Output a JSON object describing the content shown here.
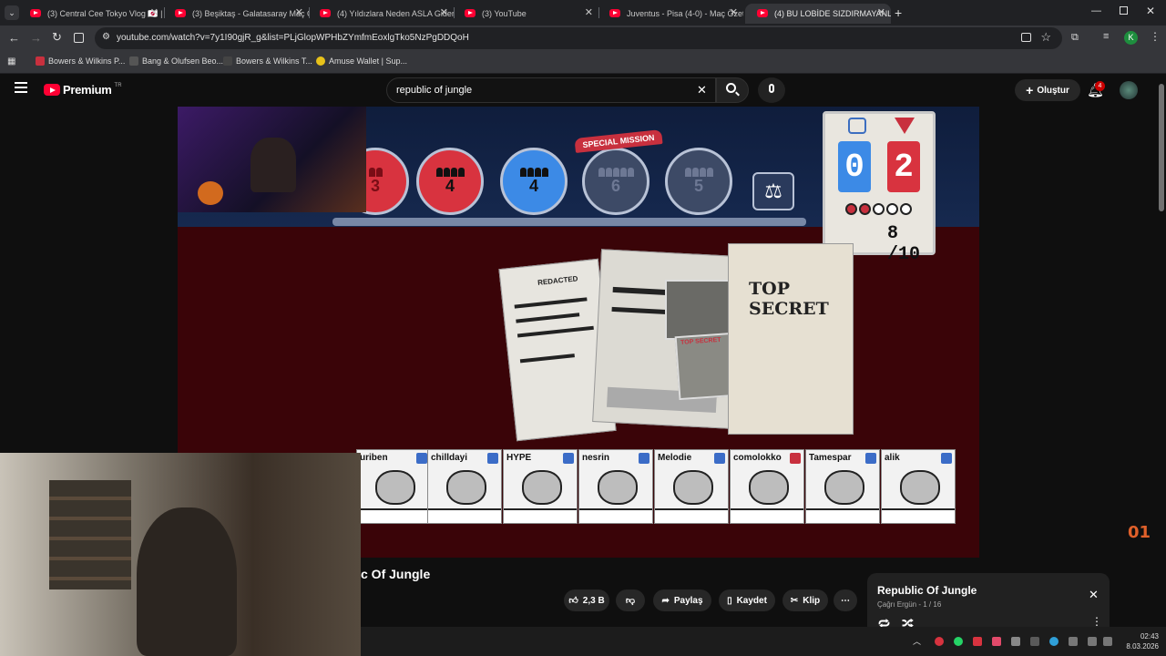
{
  "browser": {
    "tabs": [
      {
        "label": "(3) Central Cee Tokyo Vlog 🇯🇵 | (",
        "active": false
      },
      {
        "label": "(3) Beşiktaş - Galatasaray Maç Ö",
        "active": false
      },
      {
        "label": "(4) Yıldızlara Neden ASLA Gider",
        "active": false
      },
      {
        "label": "(3) YouTube",
        "active": false
      },
      {
        "label": "Juventus - Pisa (4-0) - Maç Özet",
        "active": false
      },
      {
        "label": "(4) BU LOBİDE SIZDIRMAYANLA",
        "active": true
      }
    ],
    "url": "youtube.com/watch?v=7y1I90gjR_g&list=PLjGlopWPHbZYmfmEoxlgTko5NzPgDDQoH",
    "bookmarks": [
      {
        "label": "Bowers & Wilkins P...",
        "color": "#c8303e"
      },
      {
        "label": "Bang & Olufsen Beo...",
        "color": "#555555"
      },
      {
        "label": "Bowers & Wilkins T...",
        "color": "#444444"
      },
      {
        "label": "Amuse Wallet | Sup...",
        "color": "#e8c21a"
      }
    ],
    "profile_initial": "K"
  },
  "youtube": {
    "logo_text": "Premium",
    "logo_region": "TR",
    "search_value": "republic of jungle",
    "create_label": "Oluştur",
    "notification_count": "4"
  },
  "game": {
    "missions": [
      {
        "value": "3",
        "state": "red"
      },
      {
        "value": "4",
        "state": "red"
      },
      {
        "value": "4",
        "state": "blue"
      },
      {
        "value": "6",
        "state": "empty"
      },
      {
        "value": "5",
        "state": "empty"
      }
    ],
    "special_mission_label": "SPECIAL MISSION",
    "score_blue": "0",
    "score_red": "2",
    "round_current": "8",
    "round_total": "/10",
    "votes_failed": 2,
    "votes_total": 5,
    "doc_title": "TOP SECRET",
    "doc_tag": "REDACTED",
    "doc_stamp": "TOP SECRET",
    "players": [
      {
        "name": "uriben",
        "icon": "blue"
      },
      {
        "name": "chilldayi",
        "icon": "blue"
      },
      {
        "name": "HYPE",
        "icon": "blue"
      },
      {
        "name": "nesrin",
        "icon": "blue"
      },
      {
        "name": "Melodie",
        "icon": "blue"
      },
      {
        "name": "comolokko",
        "icon": "red"
      },
      {
        "name": "Tamespar",
        "icon": "blue"
      },
      {
        "name": "alik",
        "icon": "blue"
      }
    ],
    "corner_logo": "01"
  },
  "video": {
    "title": "c Of Jungle",
    "likes": "2,3 B",
    "share_label": "Paylaş",
    "save_label": "Kaydet",
    "clip_label": "Klip"
  },
  "playlist": {
    "title": "Republic Of Jungle",
    "owner": "Çağrı Ergün",
    "position": "1 / 16"
  },
  "taskbar": {
    "time": "02:43",
    "date": "8.03.2026"
  },
  "colors": {
    "red": "#d8333f",
    "blue": "#3c8ae6",
    "empty": "#3d4a66"
  }
}
